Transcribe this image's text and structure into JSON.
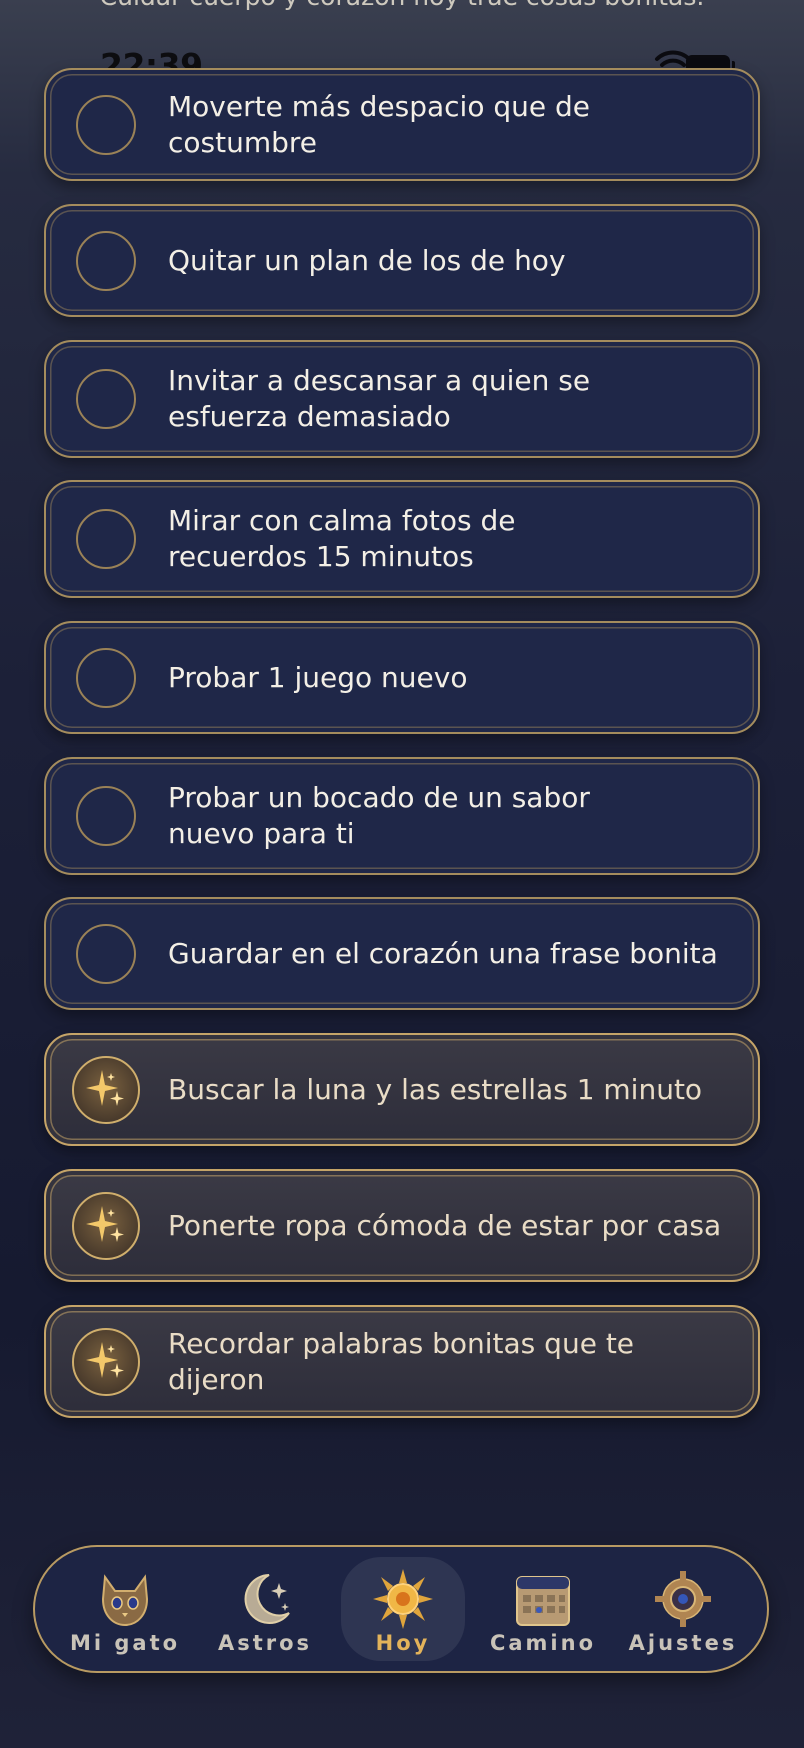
{
  "header": {
    "message": "Cuidar cuerpo y corazón hoy trae cosas bonitas."
  },
  "status_bar": {
    "time": "22:39"
  },
  "tasks": [
    {
      "label": "Moverte más despacio que de costumbre",
      "completed": false
    },
    {
      "label": "Quitar un plan de los de hoy",
      "completed": false
    },
    {
      "label": "Invitar a descansar a quien se esfuerza demasiado",
      "completed": false
    },
    {
      "label": "Mirar con calma fotos de recuerdos 15 minutos",
      "completed": false
    },
    {
      "label": "Probar 1 juego nuevo",
      "completed": false
    },
    {
      "label": "Probar un bocado de un sabor nuevo para ti",
      "completed": false
    },
    {
      "label": "Guardar en el corazón una frase bonita",
      "completed": false
    },
    {
      "label": "Buscar la luna y las estrellas 1 minuto",
      "completed": true,
      "icon": "sparkles-icon"
    },
    {
      "label": "Ponerte ropa cómoda de estar por casa",
      "completed": true,
      "icon": "sparkles-icon"
    },
    {
      "label": "Recordar palabras bonitas que te dijeron",
      "completed": true,
      "icon": "sparkles-icon"
    }
  ],
  "tabs": [
    {
      "label": "Mi gato",
      "icon": "cat-icon",
      "active": false
    },
    {
      "label": "Astros",
      "icon": "moon-stars-icon",
      "active": false
    },
    {
      "label": "Hoy",
      "icon": "sun-icon",
      "active": true
    },
    {
      "label": "Camino",
      "icon": "calendar-icon",
      "active": false
    },
    {
      "label": "Ajustes",
      "icon": "gear-icon",
      "active": false
    }
  ],
  "colors": {
    "gold": "#c5a468",
    "card_bg": "#1f2748",
    "done_bg": "#34333e",
    "active_tab": "#e3b35a"
  }
}
